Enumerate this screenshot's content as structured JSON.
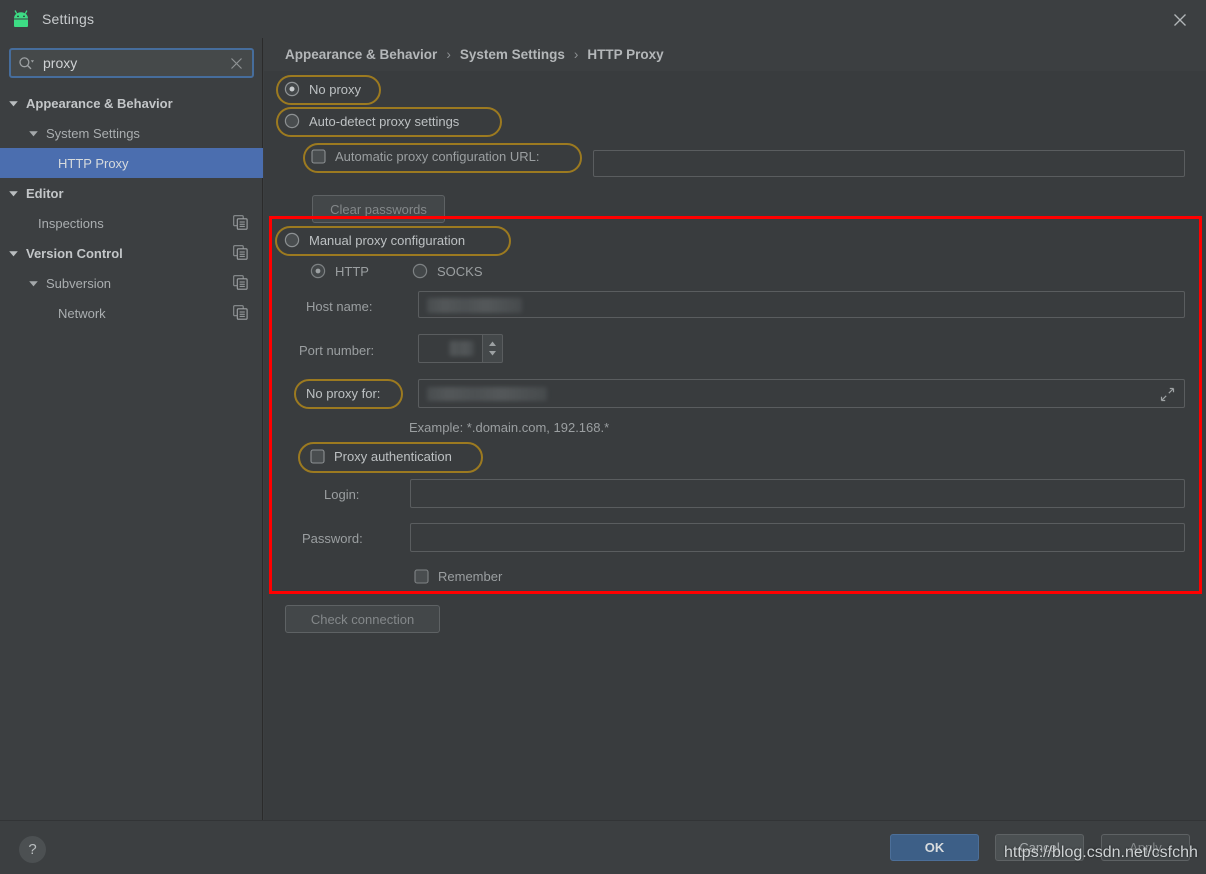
{
  "window": {
    "title": "Settings",
    "app_icon": "android-robot-icon",
    "close_icon": "close-icon"
  },
  "search": {
    "value": "proxy",
    "placeholder": "",
    "search_icon": "search-icon",
    "clear_icon": "clear-icon"
  },
  "sidebar": {
    "items": [
      {
        "label": "Appearance & Behavior",
        "indent": 8,
        "arrow": "triangle-down",
        "bold": true,
        "selected": false,
        "copy_icon": false
      },
      {
        "label": "System Settings",
        "indent": 28,
        "arrow": "triangle-down",
        "bold": false,
        "selected": false,
        "copy_icon": false
      },
      {
        "label": "HTTP Proxy",
        "indent": 58,
        "arrow": "none",
        "bold": false,
        "selected": true,
        "copy_icon": false
      },
      {
        "label": "Editor",
        "indent": 8,
        "arrow": "triangle-down",
        "bold": true,
        "selected": false,
        "copy_icon": false
      },
      {
        "label": "Inspections",
        "indent": 38,
        "arrow": "none",
        "bold": false,
        "selected": false,
        "copy_icon": true
      },
      {
        "label": "Version Control",
        "indent": 8,
        "arrow": "triangle-down",
        "bold": true,
        "selected": false,
        "copy_icon": true
      },
      {
        "label": "Subversion",
        "indent": 28,
        "arrow": "triangle-down",
        "bold": false,
        "selected": false,
        "copy_icon": true
      },
      {
        "label": "Network",
        "indent": 58,
        "arrow": "none",
        "bold": false,
        "selected": false,
        "copy_icon": true
      }
    ]
  },
  "breadcrumb": {
    "part1": "Appearance & Behavior",
    "sep1": "›",
    "part2": "System Settings",
    "sep2": "›",
    "part3": "HTTP Proxy"
  },
  "proxy_form": {
    "no_proxy_label": "No proxy",
    "no_proxy_checked": true,
    "auto_detect_label": "Auto-detect proxy settings",
    "auto_detect_checked": false,
    "auto_config_url_label": "Automatic proxy configuration URL:",
    "auto_config_url_checked": false,
    "auto_config_url_value": "",
    "clear_passwords_label": "Clear passwords",
    "manual_label": "Manual proxy configuration",
    "manual_checked": false,
    "http_label": "HTTP",
    "http_checked": true,
    "socks_label": "SOCKS",
    "socks_checked": false,
    "host_name_label": "Host name:",
    "host_name_value": "",
    "port_number_label": "Port number:",
    "port_number_value": "",
    "no_proxy_for_label": "No proxy for:",
    "no_proxy_for_value": "",
    "no_proxy_for_expand_icon": "expand-icon",
    "example_hint": "Example: *.domain.com, 192.168.*",
    "proxy_auth_label": "Proxy authentication",
    "proxy_auth_checked": false,
    "login_label": "Login:",
    "login_value": "",
    "password_label": "Password:",
    "password_value": "",
    "remember_label": "Remember",
    "remember_checked": false,
    "check_connection_label": "Check connection"
  },
  "footer": {
    "help_label": "?",
    "ok_label": "OK",
    "cancel_label": "Cancel",
    "apply_label": "Apply",
    "watermark": "https://blog.csdn.net/csfchh"
  },
  "annotation": {
    "highlight_color": "#9c7a20",
    "box_color": "#ff0000",
    "accent_color": "#4b6eaf"
  }
}
